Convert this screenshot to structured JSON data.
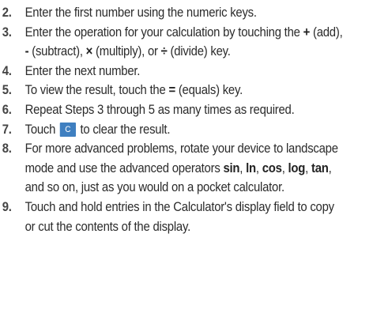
{
  "steps": [
    {
      "num": "2.",
      "lines": [
        "Enter the first number using the numeric keys."
      ]
    },
    {
      "num": "3.",
      "p1": "Enter the operation for your calculation by touching the",
      "op_add": "+",
      "t_add": " (add), ",
      "op_sub": "-",
      "t_sub": " (subtract), ",
      "op_mul": "×",
      "t_mul": " (multiply), or ",
      "op_div": "÷",
      "t_div": " (divide) key."
    },
    {
      "num": "4.",
      "lines": [
        "Enter the next number."
      ]
    },
    {
      "num": "5.",
      "pre": "To view the result, touch the ",
      "op_eq": "=",
      "post": " (equals) key."
    },
    {
      "num": "6.",
      "lines": [
        "Repeat Steps 3 through 5 as many times as required."
      ]
    },
    {
      "num": "7.",
      "pre": "Touch",
      "key": "C",
      "post": "to clear the result."
    },
    {
      "num": "8.",
      "pre": "For more advanced problems, rotate your device to landscape mode and use the advanced operators ",
      "sin": "sin",
      "c1": ", ",
      "ln": "ln",
      "c2": ", ",
      "cos": "cos",
      "c3": ", ",
      "log": "log",
      "c4": ", ",
      "tan": "tan",
      "post": ", and so on, just as you would on a pocket calculator."
    },
    {
      "num": "9.",
      "lines": [
        "Touch and hold entries in the Calculator's display field to copy or cut the contents of the display."
      ]
    }
  ],
  "colors": {
    "key_bg": "#3f7fc0"
  }
}
